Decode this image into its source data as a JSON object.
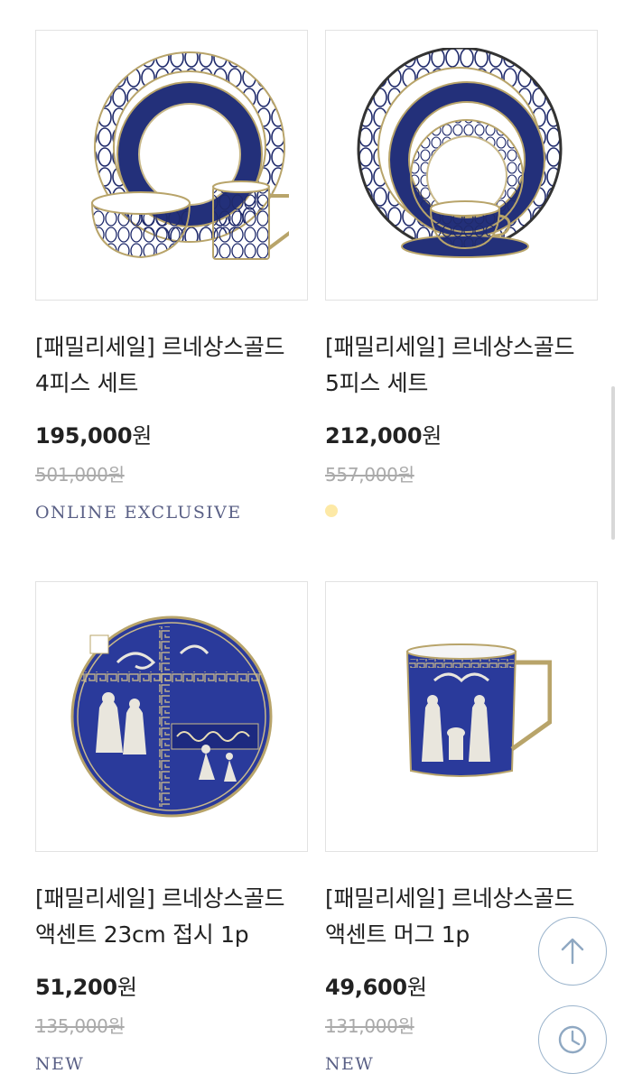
{
  "products": [
    {
      "title_line1": "[패밀리세일] 르네상스골드",
      "title_line2": "4피스 세트",
      "price": "195,000",
      "currency": "원",
      "original_price": "501,000원",
      "badge": "ONLINE EXCLUSIVE"
    },
    {
      "title_line1": "[패밀리세일] 르네상스골드",
      "title_line2": "5피스 세트",
      "price": "212,000",
      "currency": "원",
      "original_price": "557,000원",
      "color_swatch": "#fde9a6"
    },
    {
      "title_line1": "[패밀리세일] 르네상스골드",
      "title_line2": "액센트 23cm 접시 1p",
      "price": "51,200",
      "currency": "원",
      "original_price": "135,000원",
      "badge": "NEW"
    },
    {
      "title_line1": "[패밀리세일] 르네상스골드",
      "title_line2": "액센트 머그 1p",
      "price": "49,600",
      "currency": "원",
      "original_price": "131,000원",
      "badge": "NEW"
    }
  ],
  "floating_buttons": {
    "top_icon": "arrow-up-icon",
    "history_icon": "clock-icon",
    "accent_color": "#9bb4cc"
  },
  "colors": {
    "navy": "#23307a",
    "gold": "#b8a46a",
    "badge_text": "#5a6086"
  }
}
